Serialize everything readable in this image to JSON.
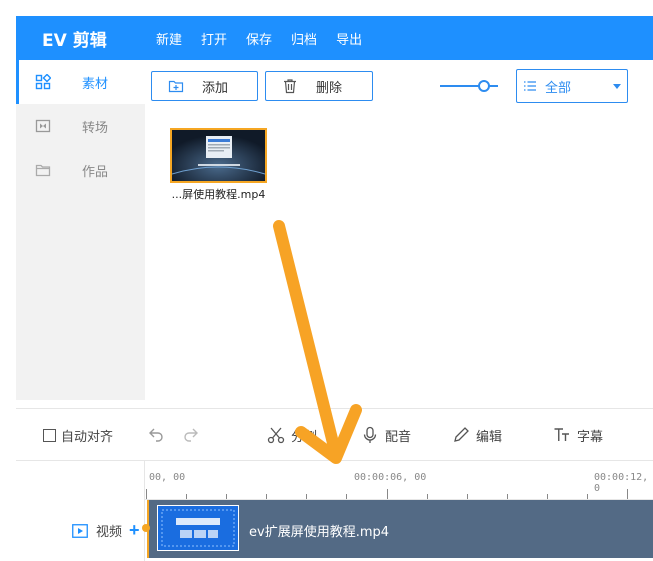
{
  "app": {
    "logo": "EV 剪辑",
    "menu": [
      "新建",
      "打开",
      "保存",
      "归档",
      "导出"
    ]
  },
  "sidebar": {
    "items": [
      {
        "label": "素材",
        "icon": "grid-icon",
        "active": true
      },
      {
        "label": "转场",
        "icon": "transition-icon",
        "active": false
      },
      {
        "label": "作品",
        "icon": "folder-icon",
        "active": false
      }
    ]
  },
  "media_panel": {
    "add_label": "添加",
    "delete_label": "删除",
    "zoom_level": 0.7,
    "filter_value": "全部",
    "items": [
      {
        "name": "...屏使用教程.mp4"
      }
    ]
  },
  "toolbar": {
    "auto_align_label": "自动对齐",
    "split_label": "分割",
    "dub_label": "配音",
    "edit_label": "编辑",
    "subtitle_label": "字幕"
  },
  "timeline": {
    "ticks": [
      "00, 00",
      "00:00:06, 00",
      "00:00:12, 0"
    ],
    "track_label": "视频",
    "clip_name": "ev扩展屏使用教程.mp4"
  },
  "colors": {
    "accent": "#1e90ff",
    "highlight": "#f5a623",
    "clip": "#536a85"
  }
}
